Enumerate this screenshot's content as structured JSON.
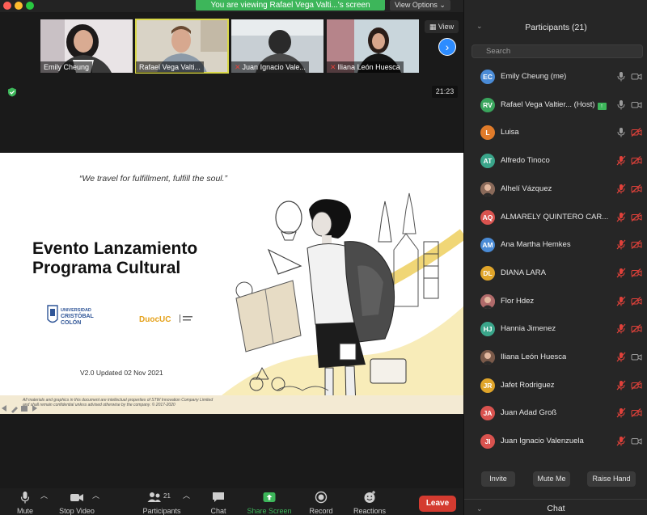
{
  "window": {
    "viewing_banner": "You are viewing Rafael Vega Valti...'s screen",
    "view_options": "View Options ⌄",
    "view_button": "View",
    "timer": "21:23"
  },
  "thumbnails": [
    {
      "name": "Emily Cheung",
      "muted": false
    },
    {
      "name": "Rafael Vega Valti...",
      "muted": false
    },
    {
      "name": "Juan Ignacio Vale...",
      "muted": true
    },
    {
      "name": "Iliana León Huesca",
      "muted": true
    }
  ],
  "slide": {
    "quote": "“We travel for fulfillment, fulfill the soul.”",
    "title_line1": "Evento Lanzamiento",
    "title_line2": "Programa Cultural",
    "ucc_logo_lines": [
      "UNIVERSIDAD",
      "CRISTÓBAL",
      "COLÓN"
    ],
    "duoc_logo_text": "DuocUC",
    "version": "V2.0 Updated 02 Nov 2021",
    "footer_line1": "All materials and graphics in this document are intellectual properties of STW Innovation Company Limited",
    "footer_line2": "and shall remain confidential unless advised otherwise by the company. © 2017-2020"
  },
  "toolbar": {
    "mute": "Mute",
    "stop_video": "Stop Video",
    "participants": "Participants",
    "participants_count": "21",
    "chat": "Chat",
    "share_screen": "Share Screen",
    "record": "Record",
    "reactions": "Reactions",
    "leave": "Leave"
  },
  "panel": {
    "title": "Participants (21)",
    "search_placeholder": "Search",
    "invite": "Invite",
    "mute_me": "Mute Me",
    "raise_hand": "Raise Hand",
    "chat_title": "Chat"
  },
  "participants": [
    {
      "initials": "EC",
      "name": "Emily Cheung (me)",
      "color": "#4a8bd6",
      "photo": false,
      "host": false,
      "mic": "on",
      "cam": "on"
    },
    {
      "initials": "RV",
      "name": "Rafael Vega Valtier... (Host)",
      "color": "#3aa55d",
      "photo": false,
      "host": true,
      "mic": "on",
      "cam": "on"
    },
    {
      "initials": "L",
      "name": "Luisa",
      "color": "#e07b2a",
      "photo": false,
      "host": false,
      "mic": "on",
      "cam": "off"
    },
    {
      "initials": "AT",
      "name": "Alfredo Tinoco",
      "color": "#3aa58a",
      "photo": false,
      "host": false,
      "mic": "off",
      "cam": "off"
    },
    {
      "initials": "",
      "name": "Alhelí Vázquez",
      "color": "#8a6a5a",
      "photo": true,
      "host": false,
      "mic": "off",
      "cam": "off"
    },
    {
      "initials": "AQ",
      "name": "ALMARELY QUINTERO CAR...",
      "color": "#d9534f",
      "photo": false,
      "host": false,
      "mic": "off",
      "cam": "off"
    },
    {
      "initials": "AM",
      "name": "Ana Martha Hemkes",
      "color": "#4a8bd6",
      "photo": false,
      "host": false,
      "mic": "off",
      "cam": "off"
    },
    {
      "initials": "DL",
      "name": "DIANA LARA",
      "color": "#e0a52a",
      "photo": false,
      "host": false,
      "mic": "off",
      "cam": "off"
    },
    {
      "initials": "",
      "name": "Flor Hdez",
      "color": "#b06a6a",
      "photo": true,
      "host": false,
      "mic": "off",
      "cam": "off"
    },
    {
      "initials": "HJ",
      "name": "Hannia Jimenez",
      "color": "#3aa58a",
      "photo": false,
      "host": false,
      "mic": "off",
      "cam": "off"
    },
    {
      "initials": "",
      "name": "Iliana León Huesca",
      "color": "#7a5a4a",
      "photo": true,
      "host": false,
      "mic": "off",
      "cam": "on"
    },
    {
      "initials": "JR",
      "name": "Jafet Rodriguez",
      "color": "#e0a52a",
      "photo": false,
      "host": false,
      "mic": "off",
      "cam": "off"
    },
    {
      "initials": "JA",
      "name": "Juan Adad Groß",
      "color": "#d9534f",
      "photo": false,
      "host": false,
      "mic": "off",
      "cam": "off"
    },
    {
      "initials": "JI",
      "name": "Juan Ignacio Valenzuela",
      "color": "#d9534f",
      "photo": false,
      "host": false,
      "mic": "off",
      "cam": "on"
    }
  ]
}
